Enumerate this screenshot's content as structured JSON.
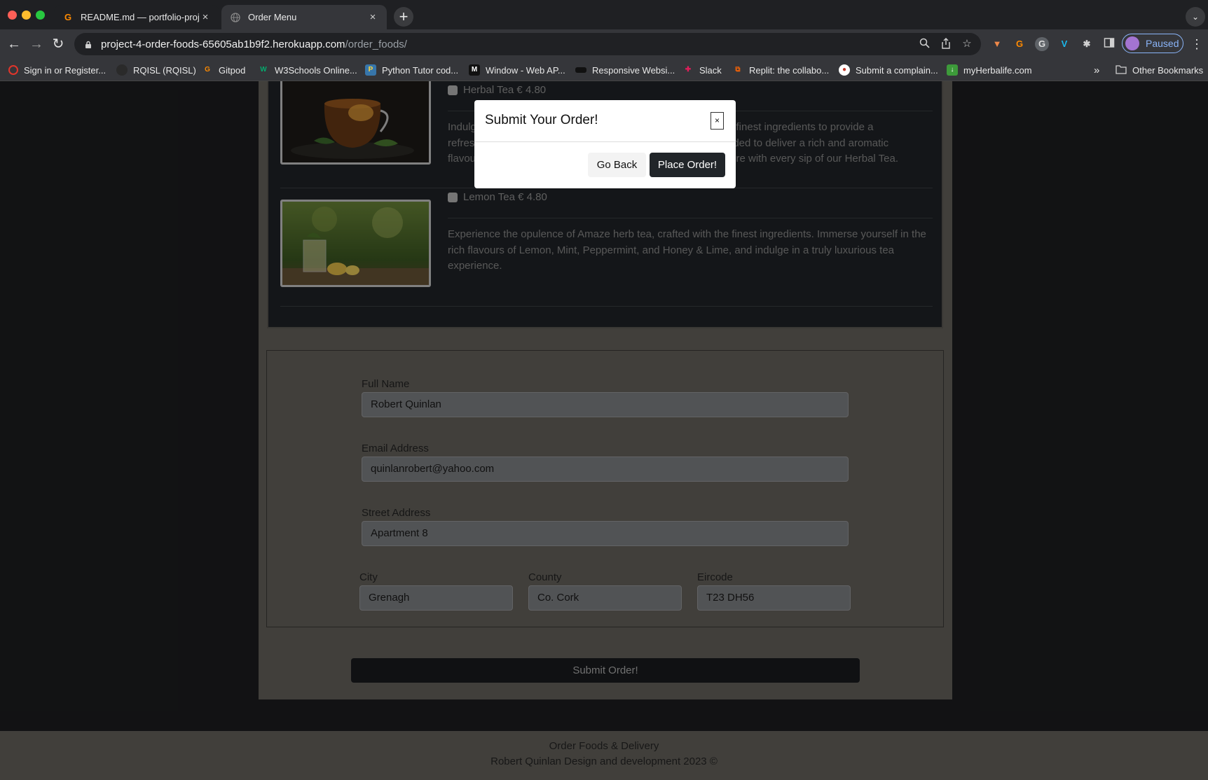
{
  "browser": {
    "tabs": [
      {
        "title": "README.md — portfolio-proje",
        "icon": "gitpod-icon",
        "active": false
      },
      {
        "title": "Order Menu",
        "icon": "globe-icon",
        "active": true
      }
    ],
    "url_host": "project-4-order-foods-65605ab1b9f2.herokuapp.com",
    "url_path": "/order_foods/",
    "profile_label": "Paused",
    "bookmarks": [
      "Sign in or Register...",
      "RQISL (RQISL)",
      "Gitpod",
      "W3Schools Online...",
      "Python Tutor cod...",
      "Window - Web AP...",
      "Responsive Websi...",
      "Slack",
      "Replit: the collabo...",
      "Submit a complain...",
      "myHerbalife.com"
    ],
    "bookmarks_overflow": "»",
    "other_bookmarks": "Other Bookmarks"
  },
  "menu": {
    "items": [
      {
        "title": "Herbal Tea € 4.80",
        "desc_lines": [
          "Indulg",
          "refres",
          "flavou"
        ],
        "desc_right_lines": [
          "e finest ingredients to provide a",
          "nded to deliver a rich and aromatic",
          "ture with every sip of our Herbal Tea."
        ]
      },
      {
        "title": "Lemon Tea € 4.80",
        "desc_lines": [
          "Experience the opulence of Amaze herb tea, crafted with the finest ingredients. Immerse yourself in the",
          "rich flavours of Lemon, Mint, Peppermint, and Honey & Lime, and indulge in a truly luxurious tea",
          "experience."
        ]
      }
    ]
  },
  "form": {
    "full_name": {
      "label": "Full Name",
      "value": "Robert Quinlan"
    },
    "email": {
      "label": "Email Address",
      "value": "quinlanrobert@yahoo.com"
    },
    "street": {
      "label": "Street Address",
      "value": "Apartment 8"
    },
    "city": {
      "label": "City",
      "value": "Grenagh"
    },
    "county": {
      "label": "County",
      "value": "Co. Cork"
    },
    "eircode": {
      "label": "Eircode",
      "value": "T23 DH56"
    },
    "submit_label": "Submit Order!"
  },
  "modal": {
    "title": "Submit Your Order!",
    "close": "×",
    "back_label": "Go Back",
    "place_label": "Place Order!"
  },
  "footer": {
    "line1": "Order Foods & Delivery",
    "line2": "Robert Quinlan Design and development 2023 ©"
  },
  "colors": {
    "page_bg": "#1d1e21",
    "container_bg": "#6a6760",
    "card_bg": "#212529",
    "input_bg": "#84868a",
    "primary_button": "#212529",
    "profile_accent": "#8ab4f8"
  }
}
